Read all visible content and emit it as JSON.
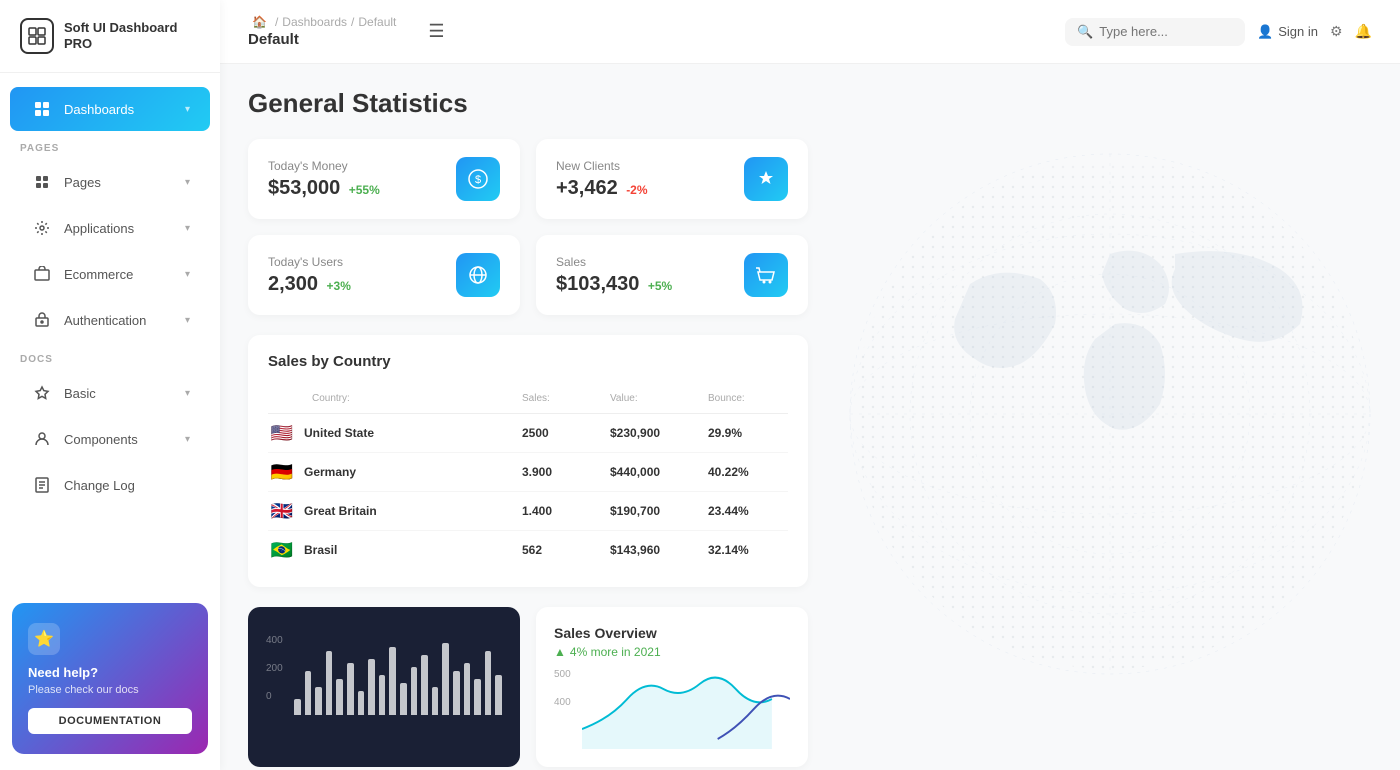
{
  "app": {
    "name": "Soft UI Dashboard PRO"
  },
  "sidebar": {
    "logo_icon": "⊞",
    "sections": [
      {
        "label": "",
        "items": [
          {
            "id": "dashboards",
            "label": "Dashboards",
            "icon": "⊟",
            "active": true,
            "has_chevron": true
          }
        ]
      },
      {
        "label": "PAGES",
        "items": [
          {
            "id": "pages",
            "label": "Pages",
            "icon": "📊",
            "active": false,
            "has_chevron": true
          },
          {
            "id": "applications",
            "label": "Applications",
            "icon": "🔧",
            "active": false,
            "has_chevron": true
          },
          {
            "id": "ecommerce",
            "label": "Ecommerce",
            "icon": "🏷",
            "active": false,
            "has_chevron": true
          },
          {
            "id": "authentication",
            "label": "Authentication",
            "icon": "📄",
            "active": false,
            "has_chevron": true
          }
        ]
      },
      {
        "label": "DOCS",
        "items": [
          {
            "id": "basic",
            "label": "Basic",
            "icon": "🚀",
            "active": false,
            "has_chevron": true
          },
          {
            "id": "components",
            "label": "Components",
            "icon": "👤",
            "active": false,
            "has_chevron": true
          },
          {
            "id": "changelog",
            "label": "Change Log",
            "icon": "📋",
            "active": false,
            "has_chevron": false
          }
        ]
      }
    ],
    "help": {
      "star": "⭐",
      "title": "Need help?",
      "subtitle": "Please check our docs",
      "button_label": "DOCUMENTATION"
    }
  },
  "header": {
    "breadcrumb": {
      "home_icon": "🏠",
      "separator": "/",
      "items": [
        "Dashboards",
        "Default"
      ]
    },
    "current_page": "Default",
    "menu_icon": "☰",
    "search_placeholder": "Type here...",
    "signin_label": "Sign in",
    "icons": [
      "⚙",
      "🔔"
    ]
  },
  "main": {
    "title": "General Statistics",
    "stats": [
      {
        "label": "Today's Money",
        "value": "$53,000",
        "change": "+55%",
        "change_type": "positive",
        "icon": "💲"
      },
      {
        "label": "New Clients",
        "value": "+3,462",
        "change": "-2%",
        "change_type": "negative",
        "icon": "🏆"
      },
      {
        "label": "Today's Users",
        "value": "2,300",
        "change": "+3%",
        "change_type": "positive",
        "icon": "🌐"
      },
      {
        "label": "Sales",
        "value": "$103,430",
        "change": "+5%",
        "change_type": "positive",
        "icon": "🛒"
      }
    ],
    "sales_by_country": {
      "title": "Sales by Country",
      "columns": [
        "Country:",
        "Sales:",
        "Value:",
        "Bounce:"
      ],
      "rows": [
        {
          "flag": "🇺🇸",
          "country": "United State",
          "sales": "2500",
          "value": "$230,900",
          "bounce": "29.9%"
        },
        {
          "flag": "🇩🇪",
          "country": "Germany",
          "sales": "3.900",
          "value": "$440,000",
          "bounce": "40.22%"
        },
        {
          "flag": "🇬🇧",
          "country": "Great Britain",
          "sales": "1.400",
          "value": "$190,700",
          "bounce": "23.44%"
        },
        {
          "flag": "🇧🇷",
          "country": "Brasil",
          "sales": "562",
          "value": "$143,960",
          "bounce": "32.14%"
        }
      ]
    },
    "bar_chart": {
      "y_labels": [
        "400",
        "200",
        "0"
      ],
      "bars": [
        20,
        55,
        35,
        80,
        45,
        65,
        30,
        70,
        50,
        85,
        40,
        60,
        75,
        35,
        90,
        55,
        65,
        45,
        80,
        50
      ]
    },
    "sales_overview": {
      "title": "Sales Overview",
      "subtitle": "4% more in 2021",
      "y_labels": [
        "500",
        "400"
      ]
    }
  }
}
